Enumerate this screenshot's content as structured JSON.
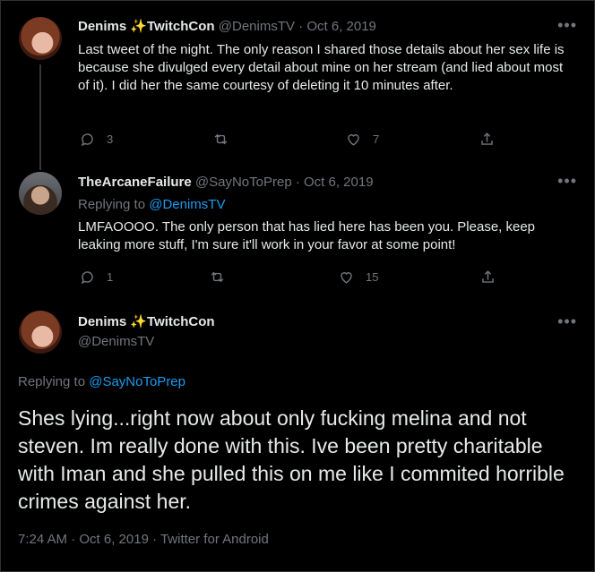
{
  "tweet1": {
    "display_name": "Denims",
    "sparkle": "✨",
    "name_suffix": "TwitchCon",
    "handle": "@DenimsTV",
    "date": "· Oct 6, 2019",
    "text": "Last tweet of the night. The only reason I shared those details about her sex life is because she divulged every detail about mine on her stream (and lied about most of it). I did her the same courtesy of deleting it 10 minutes after.",
    "reply_count": "3",
    "retweet_count": "",
    "like_count": "7",
    "more": "•••"
  },
  "tweet2": {
    "display_name": "TheArcaneFailure",
    "handle": "@SayNoToPrep",
    "date": "· Oct 6, 2019",
    "replying_prefix": "Replying to ",
    "replying_to": "@DenimsTV",
    "text": "LMFAOOOO. The only person that has lied here has been you. Please, keep leaking more stuff, I'm sure it'll work in your favor at some point!",
    "reply_count": "1",
    "retweet_count": "",
    "like_count": "15",
    "more": "•••"
  },
  "main": {
    "display_name": "Denims",
    "sparkle": "✨",
    "name_suffix": "TwitchCon",
    "handle": "@DenimsTV",
    "replying_prefix": "Replying to ",
    "replying_to": "@SayNoToPrep",
    "text": "Shes lying...right now about only fucking melina and not steven. Im really done with this. Ive been pretty charitable with Iman and she pulled this on me like I commited horrible crimes against her.",
    "timestamp": "7:24 AM · Oct 6, 2019 · Twitter for Android",
    "more": "•••"
  },
  "colors": {
    "background": "#000000",
    "text": "#e7e9ea",
    "muted": "#71767b",
    "link": "#1d9bf0"
  }
}
